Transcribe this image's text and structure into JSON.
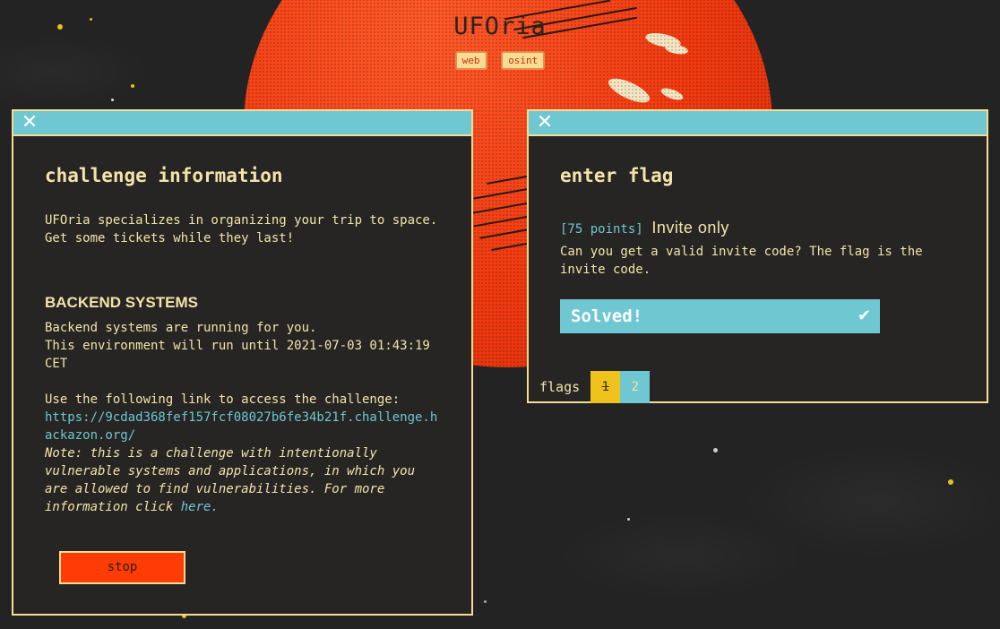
{
  "header": {
    "title": "UFOria",
    "tags": [
      "web",
      "osint"
    ]
  },
  "info_window": {
    "heading": "challenge information",
    "description": "UFOria specializes in organizing your trip to space.\nGet some tickets while they last!",
    "backend_heading": "BACKEND SYSTEMS",
    "backend_text": "Backend systems are running for you.\nThis environment will run until 2021-07-03 01:43:19 CET",
    "link_intro": "Use the following link to access the challenge:",
    "link_url": "https://9cdad368fef157fcf08027b6fe34b21f.challenge.hackazon.org/",
    "note_text": "Note: this is a challenge with intentionally vulnerable systems and applications, in which you are allowed to find vulnerabilities. For more information click ",
    "note_link": "here.",
    "stop_label": "stop"
  },
  "flag_window": {
    "heading": "enter flag",
    "points": "[75 points]",
    "challenge_name": "Invite only",
    "question": "Can you get a valid invite code? The flag is the invite code.",
    "solved_label": "Solved!",
    "flags_label": "flags",
    "flag_tabs": [
      "1",
      "2"
    ]
  },
  "colors": {
    "accent": "#6ec7d1",
    "border": "#f6dc94",
    "planet": "#f23a10",
    "stop": "#ff3b06",
    "active_flag": "#f0c21c"
  },
  "icons": [
    "close-icon",
    "checkmark-icon"
  ]
}
